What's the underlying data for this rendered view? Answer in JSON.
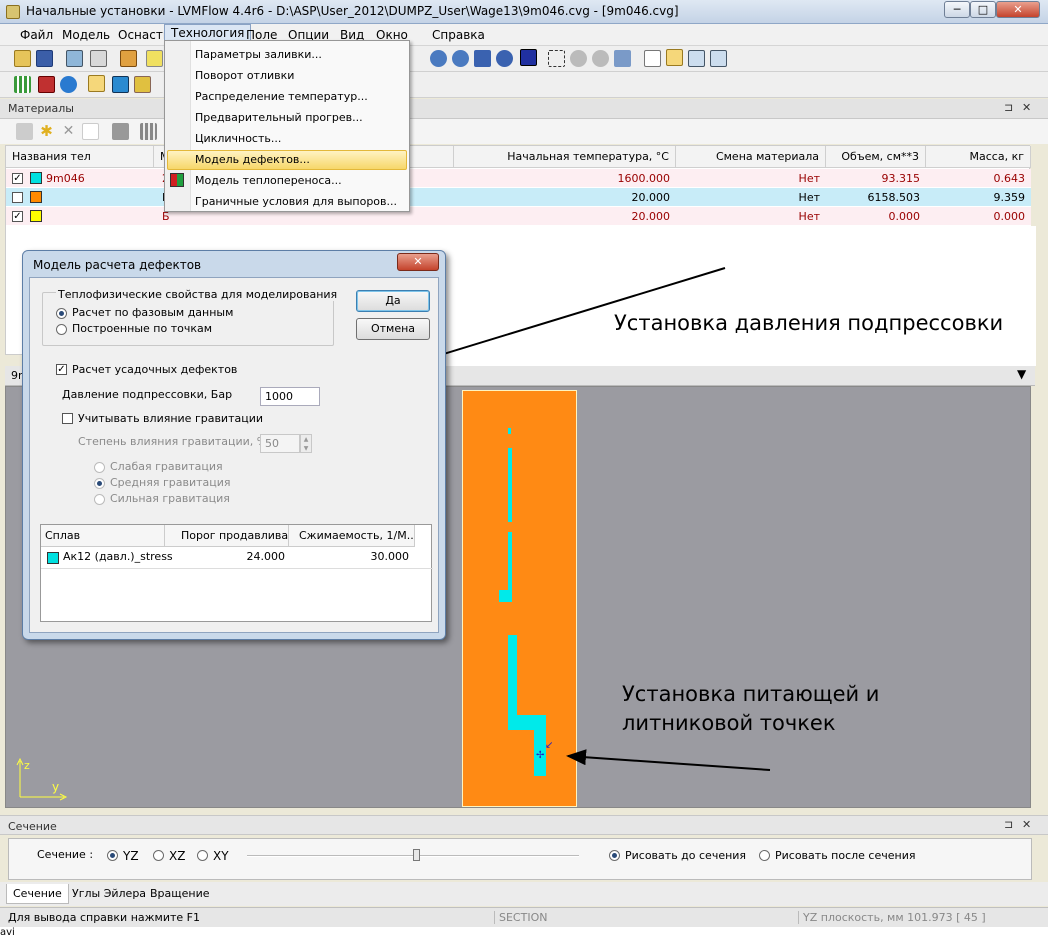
{
  "window": {
    "title": "Начальные установки - LVMFlow 4.4r6 - D:\\ASP\\User_2012\\DUMPZ_User\\Wage13\\9m046.cvg - [9m046.cvg]",
    "minimize": "─",
    "maximize": "□",
    "close": "✕"
  },
  "menubar": {
    "items": [
      "Файл",
      "Модель",
      "Оснастка",
      "Технология",
      "Поле",
      "Опции",
      "Вид",
      "Окно",
      "Справка"
    ]
  },
  "tech_menu": {
    "items": [
      "Параметры заливки...",
      "Поворот отливки",
      "Распределение температур...",
      "Предварительный прогрев...",
      "Цикличность...",
      "Модель дефектов...",
      "Модель теплопереноса...",
      "Граничные условия для выпоров..."
    ],
    "highlighted_index": 5
  },
  "materials_panel": {
    "title": "Материалы",
    "columns": [
      "Названия тел",
      "М",
      "Начальная температура, °C",
      "Смена материала",
      "Объем, см**3",
      "Масса, кг"
    ],
    "rows": [
      {
        "checked": true,
        "color": "#00e0e0",
        "name": "9m046",
        "col2": "2",
        "temp": "1600.000",
        "change": "Нет",
        "volume": "93.315",
        "mass": "0.643",
        "bg": "#fdeef2"
      },
      {
        "checked": false,
        "color": "#ff8a00",
        "name": "",
        "col2": "Н",
        "temp": "20.000",
        "change": "Нет",
        "volume": "6158.503",
        "mass": "9.359",
        "bg": "#c8ecf8"
      },
      {
        "checked": true,
        "color": "#ffff00",
        "name": "",
        "col2": "Б",
        "temp": "20.000",
        "change": "Нет",
        "volume": "0.000",
        "mass": "0.000",
        "bg": "#fdeef2"
      }
    ]
  },
  "dialog": {
    "title": "Модель расчета дефектов",
    "close": "✕",
    "group_title": "Теплофизические свойства для моделирования",
    "radio_phase": "Расчет по фазовым данным",
    "radio_points": "Построенные по точкам",
    "ok": "Да",
    "cancel": "Отмена",
    "shrink_check": "Расчет усадочных дефектов",
    "pressure_label": "Давление подпрессовки, Бар",
    "pressure_value": "1000",
    "gravity_check": "Учитывать влияние гравитации",
    "gravity_degree_label": "Степень влияния гравитации, %",
    "gravity_degree_value": "50",
    "grav_weak": "Слабая гравитация",
    "grav_medium": "Средняя гравитация",
    "grav_strong": "Сильная гравитация",
    "table": {
      "headers": [
        "Сплав",
        "Порог продавлива...",
        "Сжимаемость, 1/М..."
      ],
      "rows": [
        {
          "alloy": "Ак12 (давл.)_stress",
          "threshold": "24.000",
          "compress": "30.000",
          "color": "#00e0e0"
        }
      ]
    }
  },
  "view": {
    "tab": "9m",
    "axis_z": "z",
    "axis_y": "y"
  },
  "annotations": {
    "pressure": "Установка давления подпрессовки",
    "feed_line1": "Установка питающей и",
    "feed_line2": "литниковой точкек"
  },
  "section_panel": {
    "title": "Сечение",
    "label": "Сечение :",
    "planes": [
      "YZ",
      "XZ",
      "XY"
    ],
    "selected_plane": "YZ",
    "before": "Рисовать до сечения",
    "after": "Рисовать после сечения",
    "tabs": [
      "Сечение",
      "Углы Эйлера",
      "Вращение"
    ]
  },
  "statusbar": {
    "help": "Для вывода справки нажмите F1",
    "mode": "SECTION",
    "coords": "YZ плоскость, мм  101.973  [ 45 ]"
  },
  "taskbar_fragment": "avi"
}
